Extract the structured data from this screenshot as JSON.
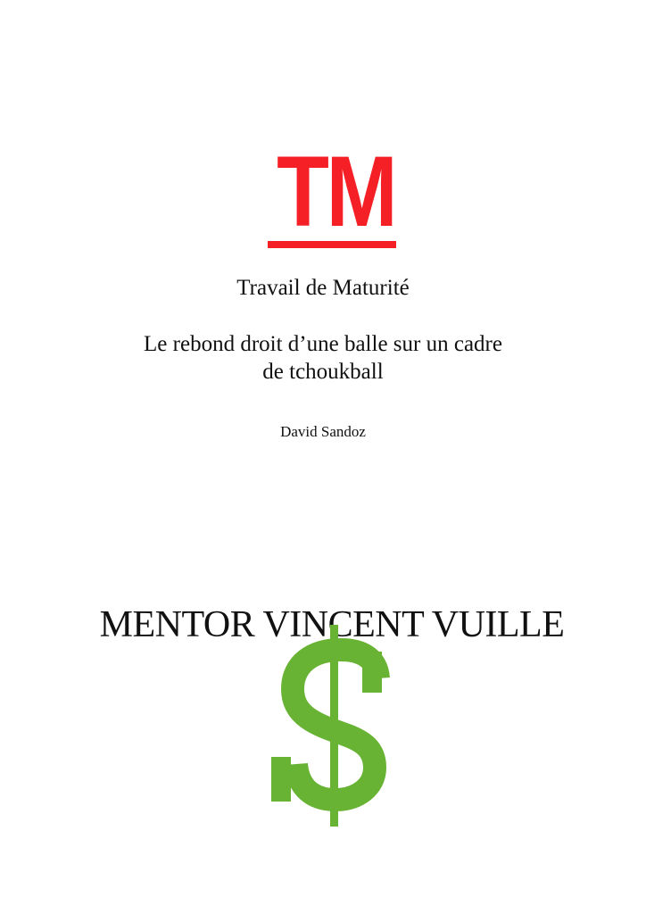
{
  "logo": {
    "text": "TM",
    "color": "#f42026"
  },
  "document": {
    "type_label": "Travail de Maturité",
    "title": "Le rebond droit d’une balle sur un cadre de tchoukball",
    "author": "David Sandoz"
  },
  "mentor": {
    "text": "MENTOR VINCENT VUILLE"
  },
  "dollar_icon": {
    "color": "#68b334"
  }
}
